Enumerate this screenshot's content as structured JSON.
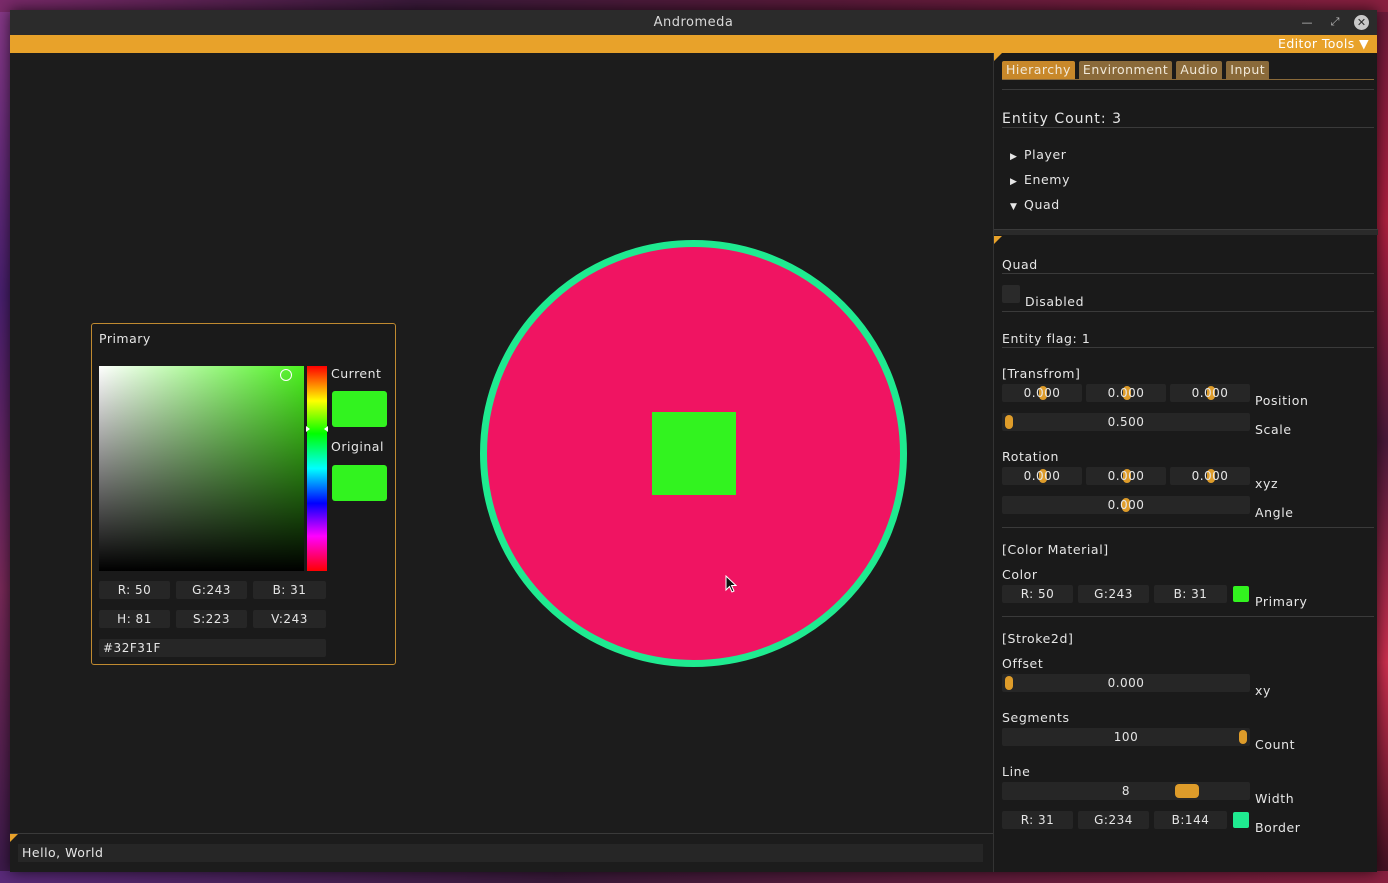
{
  "window": {
    "title": "Andromeda"
  },
  "menubar": {
    "editor_tools": "Editor Tools ▼"
  },
  "color_picker": {
    "title": "Primary",
    "current_label": "Current",
    "original_label": "Original",
    "r": "R: 50",
    "g": "G:243",
    "b": "B: 31",
    "h": "H: 81",
    "s": "S:223",
    "v": "V:243",
    "hex": "#32F31F"
  },
  "console": {
    "text": "Hello, World"
  },
  "side": {
    "tabs": [
      "Hierarchy",
      "Environment",
      "Audio",
      "Input"
    ],
    "entity_count": "Entity Count: 3",
    "tree": [
      {
        "arrow": "▶",
        "label": "Player"
      },
      {
        "arrow": "▶",
        "label": "Enemy"
      },
      {
        "arrow": "▼",
        "label": "Quad"
      }
    ],
    "inspector": {
      "name": "Quad",
      "disabled_label": "Disabled",
      "entity_flag": "Entity flag: 1",
      "transform_header": "[Transfrom]",
      "position": [
        "0.000",
        "0.000",
        "0.000"
      ],
      "position_label": "Position",
      "scale": "0.500",
      "scale_label": "Scale",
      "rotation_label": "Rotation",
      "rotation": [
        "0.000",
        "0.000",
        "0.000"
      ],
      "rotation_xyz_label": "xyz",
      "angle": "0.000",
      "angle_label": "Angle",
      "color_material_header": "[Color Material]",
      "color_label": "Color",
      "color": {
        "r": "R: 50",
        "g": "G:243",
        "b": "B: 31",
        "swatch": "#32f31f",
        "name": "Primary"
      },
      "stroke_header": "[Stroke2d]",
      "offset_label": "Offset",
      "offset": "0.000",
      "offset_suffix": "xy",
      "segments_label": "Segments",
      "segments": "100",
      "segments_suffix": "Count",
      "line_label": "Line",
      "line_width": "8",
      "line_suffix": "Width",
      "border": {
        "r": "R: 31",
        "g": "G:234",
        "b": "B:144",
        "swatch": "#1fea90",
        "name": "Border"
      }
    }
  },
  "colors": {
    "accent": "#e8a22a",
    "circle_fill": "#f01462",
    "circle_border": "#1fea90",
    "square_fill": "#32f31f"
  }
}
